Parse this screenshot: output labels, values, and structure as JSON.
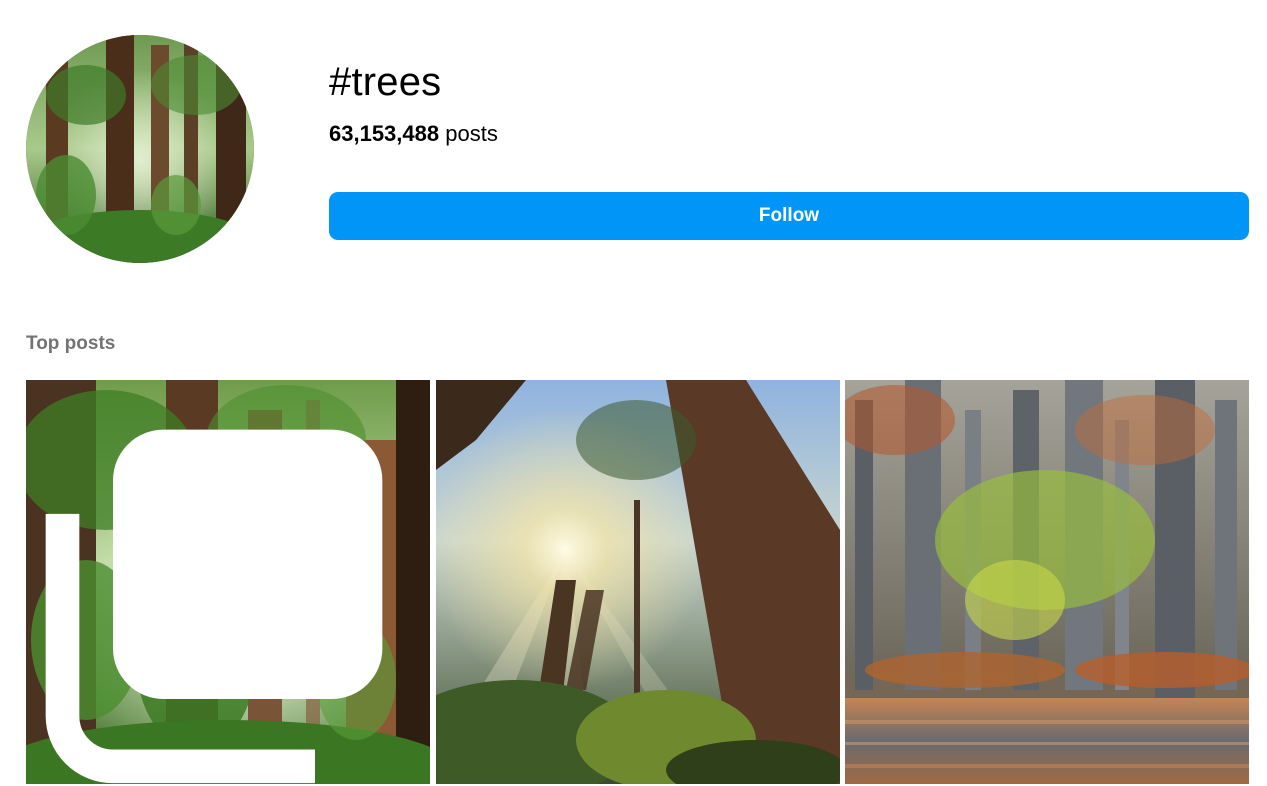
{
  "hashtag": {
    "title": "#trees",
    "post_count": "63,153,488",
    "post_count_suffix": "posts",
    "avatar_alt": "hashtag-avatar-redwood-forest"
  },
  "actions": {
    "follow_label": "Follow"
  },
  "top_posts": {
    "heading": "Top posts",
    "items": [
      {
        "description": "redwood forest with mist and ferns",
        "multi": true
      },
      {
        "description": "looking up at redwoods with sunbeams",
        "multi": false
      },
      {
        "description": "cypress swamp with autumn leaves and water reflection",
        "multi": false
      }
    ]
  },
  "colors": {
    "accent": "#0095f6",
    "muted_text": "#737373",
    "background": "#ffffff"
  },
  "icons": {
    "multi_post": "carousel-icon"
  }
}
